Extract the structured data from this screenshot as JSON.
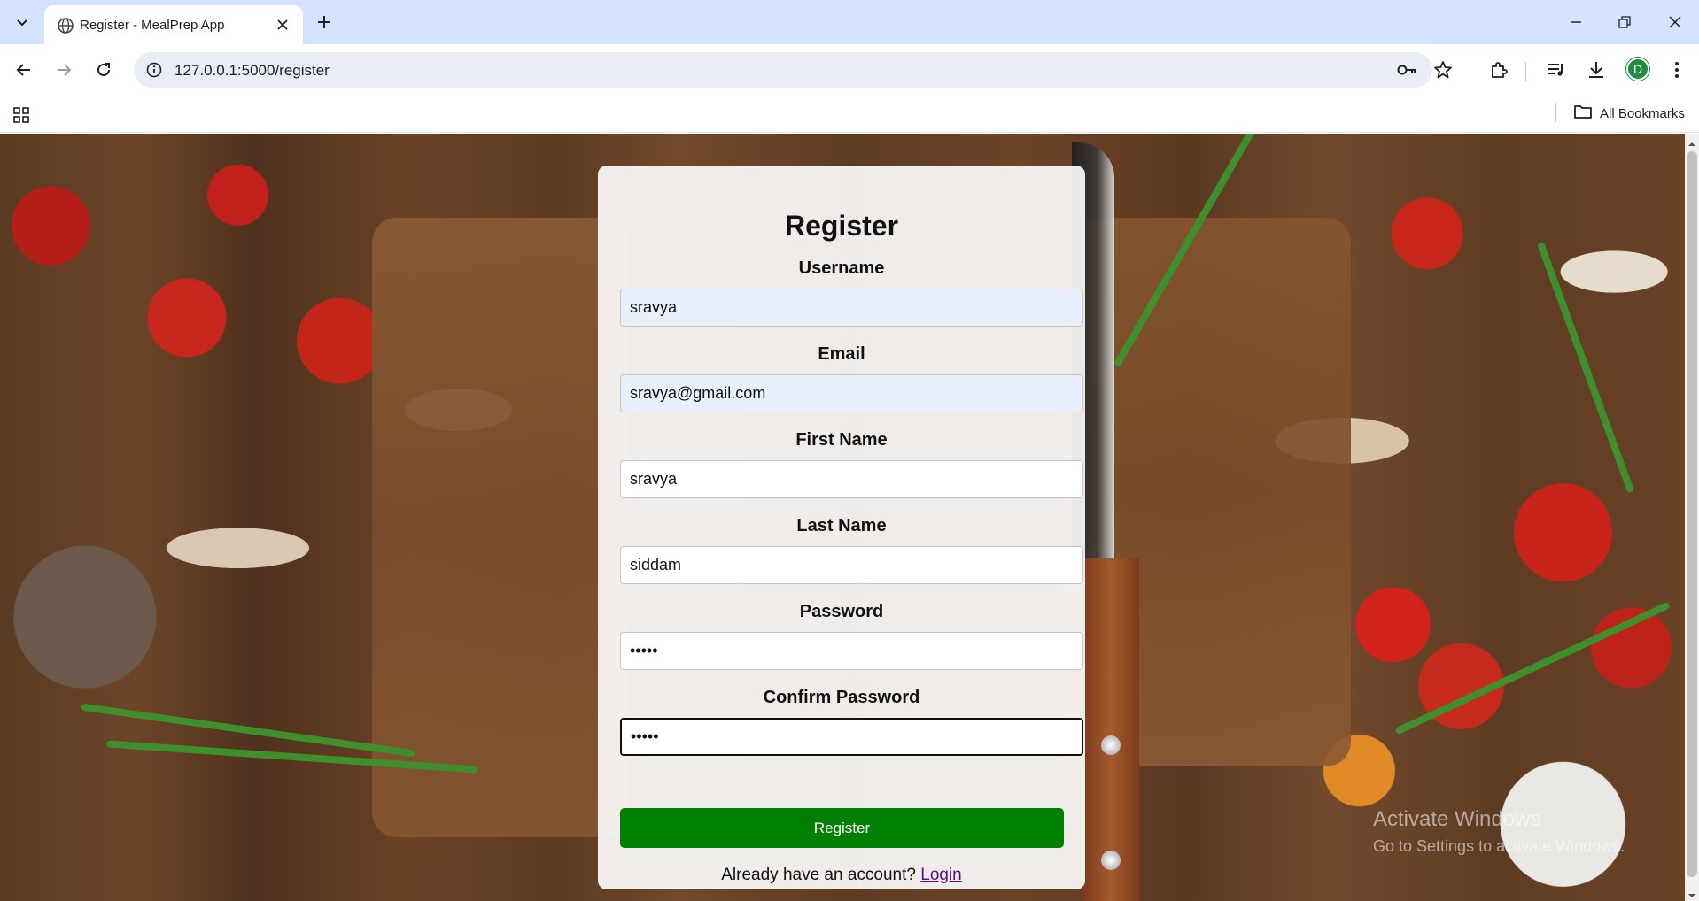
{
  "browser": {
    "tab_title": "Register - MealPrep App",
    "url": "127.0.0.1:5000/register",
    "bookmarks_label": "All Bookmarks",
    "profile_initial": "D"
  },
  "form": {
    "title": "Register",
    "fields": [
      {
        "label": "Username",
        "value": "sravya"
      },
      {
        "label": "Email",
        "value": "sravya@gmail.com"
      },
      {
        "label": "First Name",
        "value": "sravya"
      },
      {
        "label": "Last Name",
        "value": "siddam"
      },
      {
        "label": "Password",
        "value": "•••••"
      },
      {
        "label": "Confirm Password",
        "value": "•••••"
      }
    ],
    "submit_label": "Register",
    "login_prompt": "Already have an account?",
    "login_link": "Login"
  },
  "watermark": {
    "line1": "Activate Windows",
    "line2": "Go to Settings to activate Windows."
  },
  "colors": {
    "submit": "#008000",
    "link": "#5a0e8a",
    "autofill": "#e8f0fe"
  }
}
